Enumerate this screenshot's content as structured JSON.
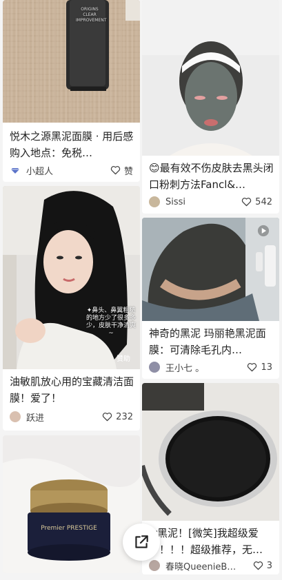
{
  "cards": [
    {
      "title": "悦木之源黑泥面膜 · 用后感 购入地点：免税…",
      "author": "小超人",
      "likes": "赞",
      "product_label": "ORIGINS CLEAR IMPROVEMENT"
    },
    {
      "title": "😊最有效不伤皮肤去黑头闭口粉刺方法Fancl&…",
      "author": "Sissi",
      "likes": "542"
    },
    {
      "title": "油敏肌放心用的宝藏清洁面膜！爱了！",
      "author": "跃进",
      "likes": "232",
      "overlay": "✦鼻头、鼻翼粗糙的地方少了很多多少，皮肤干净清爽~",
      "ad_label": "赞助"
    },
    {
      "title": "神奇的黑泥 玛丽艳黑泥面膜：可清除毛孔内…",
      "author": "王小七 。",
      "likes": "13"
    },
    {
      "title": "",
      "author": "",
      "likes": "",
      "product_label": "Premier PRESTIGE"
    },
    {
      "title": "tr黑泥！[微笑]我超级爱了！！！超级推荐，无…",
      "author": "春晓QueenieB…",
      "likes": "3"
    }
  ],
  "colors": {
    "background": "#f4f4f4",
    "card": "#ffffff",
    "text": "#222222"
  },
  "icons": {
    "like": "heart-outline-icon",
    "share": "share-arrow-icon",
    "video": "video-play-icon"
  }
}
